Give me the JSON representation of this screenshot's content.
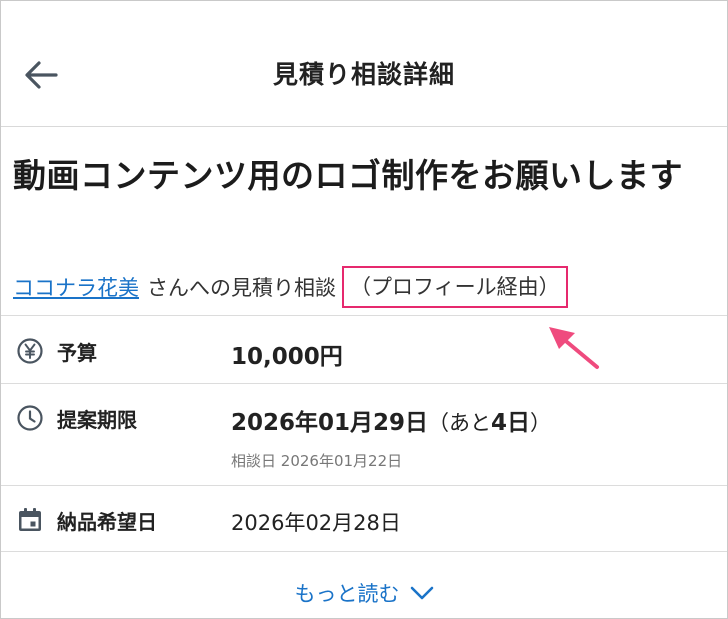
{
  "header": {
    "title": "見積り相談詳細"
  },
  "request": {
    "title": "動画コンテンツ用のロゴ制作をお願いします",
    "seller_name": "ココナラ花美",
    "seller_suffix": "さんへの見積り相談",
    "via_label": "（プロフィール経由）"
  },
  "details": {
    "budget": {
      "label": "予算",
      "value": "10,000円"
    },
    "deadline": {
      "label": "提案期限",
      "date": "2026年01月29日",
      "remaining_prefix": "（あと",
      "remaining_days": "4日",
      "remaining_suffix": "）",
      "consult_label": "相談日",
      "consult_date": "2026年01月22日"
    },
    "delivery": {
      "label": "納品希望日",
      "value": "2026年02月28日"
    }
  },
  "more": {
    "label": "もっと読む"
  },
  "colors": {
    "link": "#1a73c8",
    "highlight": "#e6296e",
    "arrow": "#ef4b7e"
  },
  "icons": [
    "back-arrow-icon",
    "yen-icon",
    "clock-icon",
    "calendar-icon",
    "chevron-down-icon",
    "pointer-arrow-icon"
  ]
}
